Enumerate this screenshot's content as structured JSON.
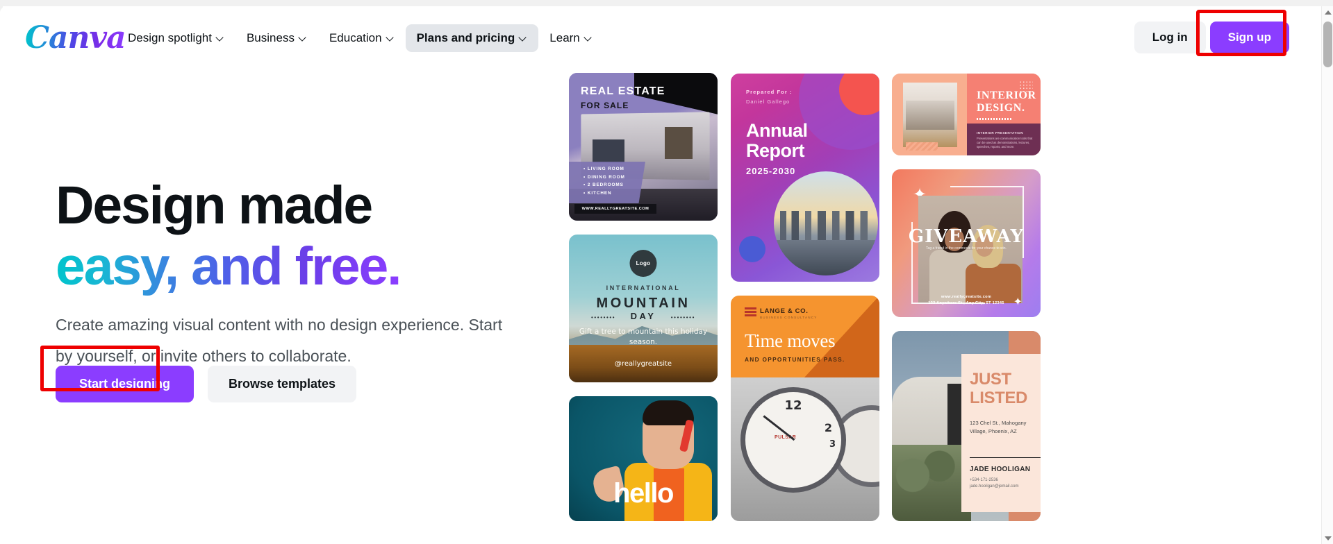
{
  "brand": {
    "logo_text": "Canva",
    "accent_purple": "#8b3dff",
    "accent_teal": "#00c4cc",
    "annotation_red": "#ee0000"
  },
  "nav": {
    "items": [
      {
        "label": "Design spotlight",
        "icon": "chevron-down-icon",
        "active": false
      },
      {
        "label": "Business",
        "icon": "chevron-down-icon",
        "active": false
      },
      {
        "label": "Education",
        "icon": "chevron-down-icon",
        "active": false
      },
      {
        "label": "Plans and pricing",
        "icon": "chevron-down-icon",
        "active": true
      },
      {
        "label": "Learn",
        "icon": "chevron-down-icon",
        "active": false
      }
    ],
    "login_label": "Log in",
    "signup_label": "Sign up"
  },
  "hero": {
    "heading_line1": "Design made",
    "heading_line2": "easy, and free.",
    "paragraph": "Create amazing visual content with no design experience. Start by yourself, or invite others to collaborate.",
    "primary_cta": "Start designing",
    "secondary_cta": "Browse templates"
  },
  "scrollbar": {
    "up_icon": "scroll-up-arrow-icon",
    "down_icon": "scroll-down-arrow-icon"
  },
  "templates": [
    {
      "id": "real-estate",
      "title": "REAL ESTATE",
      "subtitle": "FOR SALE",
      "features": [
        "LIVING ROOM",
        "DINING ROOM",
        "2 BEDROOMS",
        "KITCHEN"
      ],
      "url": "WWW.REALLYGREATSITE.COM"
    },
    {
      "id": "mountain-day",
      "logo": "Logo",
      "kicker": "INTERNATIONAL",
      "title": "MOUNTAIN",
      "subtitle": "DAY",
      "dots_left": "••••••••",
      "dots_right": "••••••••",
      "tagline": "Gift a tree to mountain this holiday season.",
      "handle": "@reallygreatsite"
    },
    {
      "id": "hello",
      "word": "hello"
    },
    {
      "id": "annual-report",
      "prepared_for": "Prepared For :",
      "person": "Daniel Gallego",
      "title": "Annual Report",
      "years": "2025-2030"
    },
    {
      "id": "time-moves",
      "brand": "LANGE & CO.",
      "brand_sub": "BUSINESS CONSULTANCY",
      "title": "Time moves",
      "subtitle": "AND OPPORTUNITIES PASS.",
      "clock_12": "12",
      "clock_2": "2",
      "clock_3": "3",
      "clock_brand": "PULSAR"
    },
    {
      "id": "interior-design",
      "title": "INTERIOR DESIGN.",
      "section": "INTERIOR PRESENTATION",
      "body": "Presentations are communication tools that can be used as demonstrations, lectures, speeches, reports, and more."
    },
    {
      "id": "giveaway",
      "word": "GIVEAWAY",
      "tagline": "Tag a friend in the comments for your chance to win.",
      "url": "www.reallygreatsite.com",
      "address": "123 Anywhere St., Any City, ST 12345"
    },
    {
      "id": "just-listed",
      "title": "JUST LISTED",
      "address": "123 Chel St., Mahogany Village, Phoenix, AZ",
      "agent": "JADE HOOLIGAN",
      "phone": "+534-171-2536",
      "email": "jade.hooligan@jemail.com"
    }
  ]
}
